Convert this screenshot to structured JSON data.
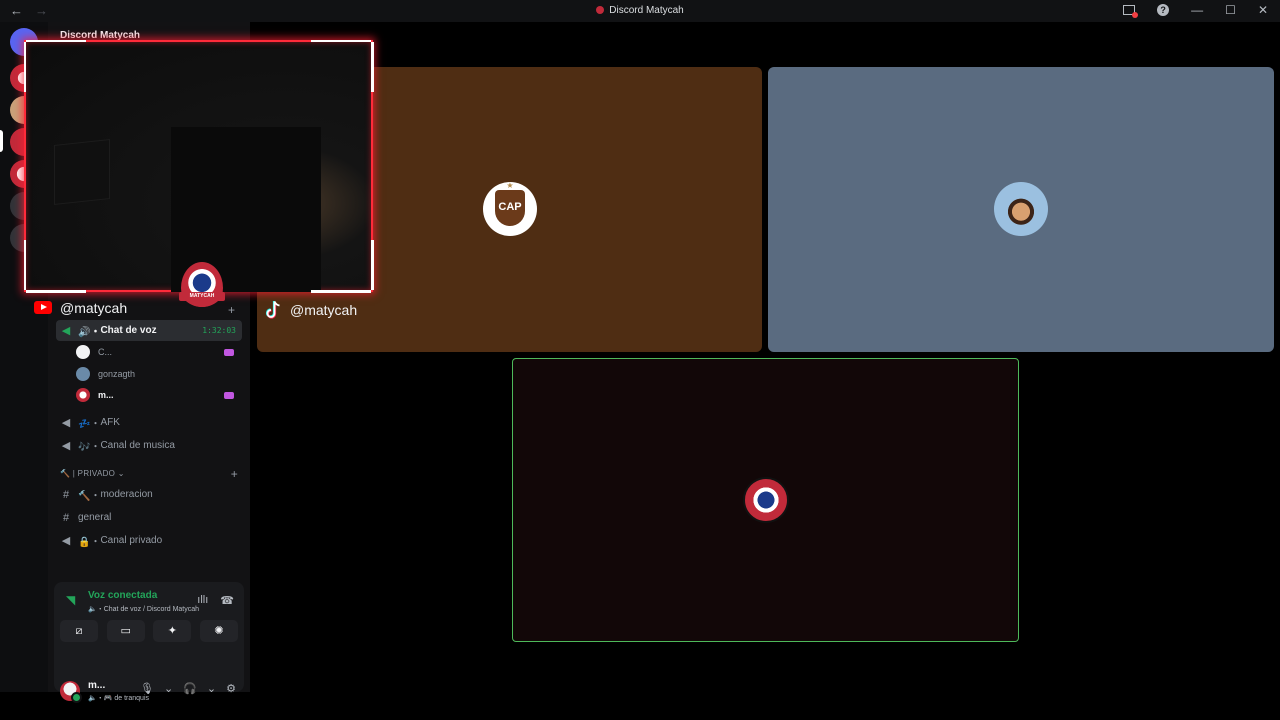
{
  "window": {
    "title": "Discord Matycah",
    "back_icon": "←",
    "forward_icon": "→",
    "help_glyph": "?",
    "minimize_glyph": "—",
    "maximize_glyph": "☐",
    "close_glyph": "✕"
  },
  "server": {
    "name": "Discord Matycah"
  },
  "overlay": {
    "youtube_handle": "@matycah",
    "tiktok_handle": "@matycah",
    "logo_text": "MATYCAH"
  },
  "channels": {
    "voice_active": {
      "name": "Chat de voz",
      "prefix": "🔊・",
      "timer": "1:32:03"
    },
    "voice_users": [
      {
        "name": "C..."
      },
      {
        "name": "gonzagth"
      },
      {
        "name": "m..."
      }
    ],
    "afk": {
      "name": "AFK",
      "prefix": "💤・"
    },
    "music": {
      "name": "Canal de musica",
      "prefix": "🎶・"
    },
    "category_private": "🔨 | PRIVADO ⌄",
    "moderacion": {
      "name": "moderacion",
      "prefix": "🔨・"
    },
    "general": {
      "name": "general"
    },
    "private_channel": {
      "name": "Canal privado",
      "prefix": "🔒・"
    }
  },
  "voice_panel": {
    "status": "Voz conectada",
    "subtitle": "🔈・Chat de voz / Discord Matycah"
  },
  "user": {
    "name": "m...",
    "status": "🔈・🎮 de tranquis"
  },
  "tiles": [
    {
      "label": "CAP",
      "color": "#4f2d13"
    },
    {
      "label": "",
      "color": "#5a6b80"
    },
    {
      "label": "",
      "color": "#120708"
    }
  ],
  "colors": {
    "accent_green": "#23a55a",
    "webcam_border": "#ff2b3a",
    "speaking_border": "#4eb95a"
  }
}
